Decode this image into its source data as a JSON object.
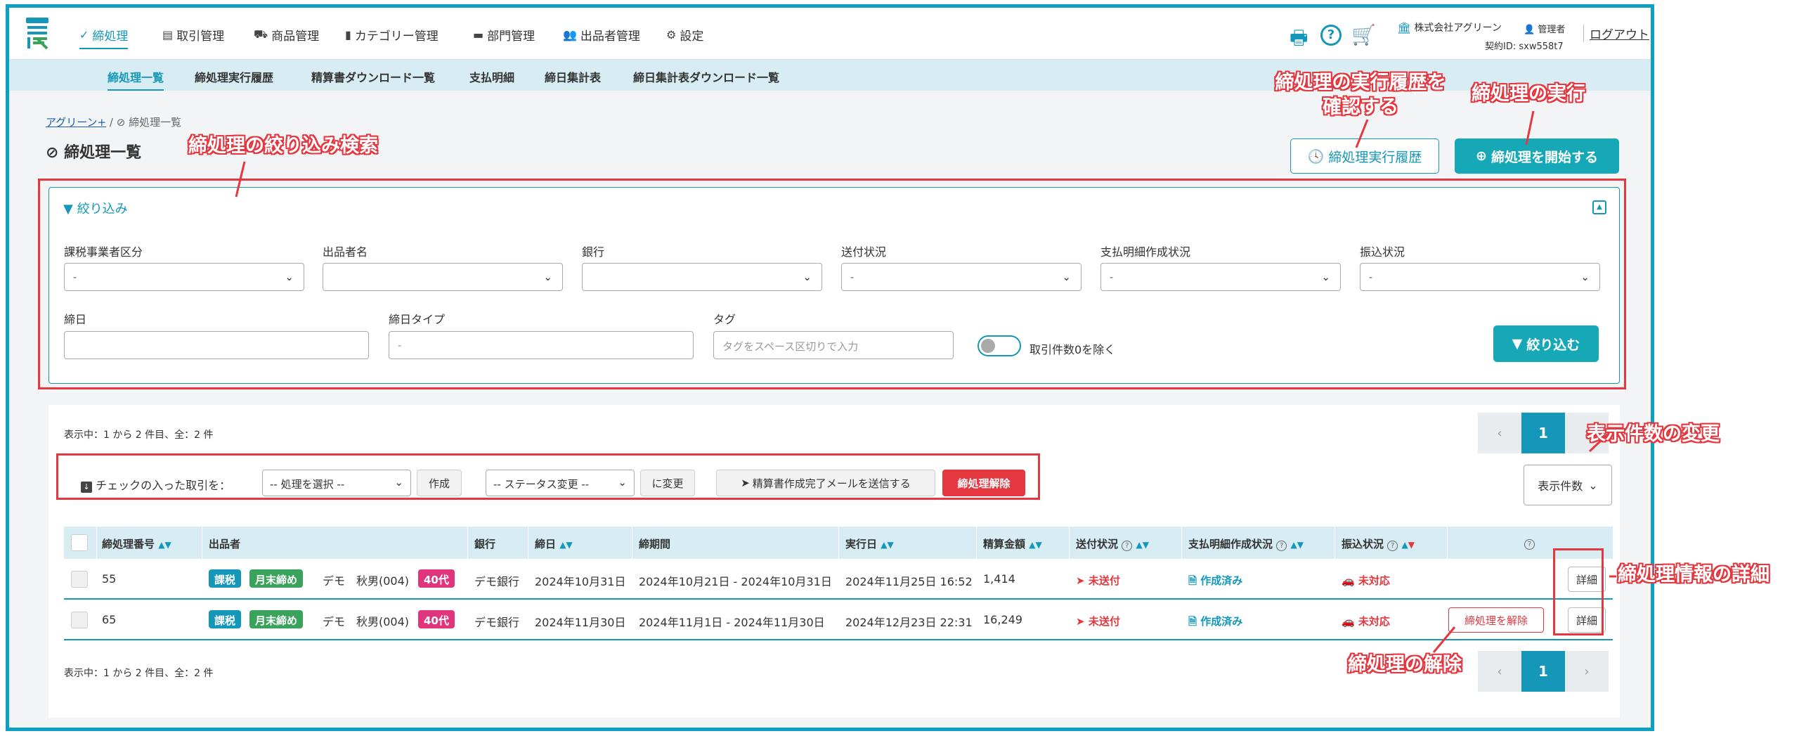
{
  "nav": {
    "items": [
      "締処理",
      "取引管理",
      "商品管理",
      "カテゴリー管理",
      "部門管理",
      "出品者管理",
      "設定"
    ],
    "company": "株式会社アグリーン",
    "user": "管理者",
    "contract": "契約ID: sxw558t7",
    "logout": "ログアウト"
  },
  "subnav": {
    "items": [
      "締処理一覧",
      "締処理実行履歴",
      "精算書ダウンロード一覧",
      "支払明細",
      "締日集計表",
      "締日集計表ダウンロード一覧"
    ]
  },
  "breadcrumb": {
    "root": "アグリーン+",
    "sep": "/",
    "current": "締処理一覧"
  },
  "page_title": "締処理一覧",
  "buttons": {
    "history": "締処理実行履歴",
    "start": "締処理を開始する"
  },
  "filter": {
    "title": "絞り込み",
    "tax_label": "課税事業者区分",
    "tax_value": "-",
    "seller_label": "出品者名",
    "seller_value": "",
    "bank_label": "銀行",
    "bank_value": "",
    "send_label": "送付状況",
    "send_value": "-",
    "pay_label": "支払明細作成状況",
    "pay_value": "-",
    "transfer_label": "振込状況",
    "transfer_value": "-",
    "close_label": "締日",
    "close_value": "",
    "close_type_label": "締日タイプ",
    "close_type_value": "-",
    "tag_label": "タグ",
    "tag_placeholder": "タグをスペース区切りで入力",
    "exclude_zero": "取引件数0を除く",
    "submit": "絞り込む"
  },
  "list": {
    "summary_top": "表示中：1 から 2 件目、全：2 件",
    "summary_bottom": "表示中：1 から 2 件目、全：2 件",
    "page": "1",
    "prev": "‹",
    "next": "›",
    "bulk_label": "チェックの入った取引を：",
    "process_select": "-- 処理を選択 --",
    "create": "作成",
    "status_select": "-- ステータス変更 --",
    "change": "に変更",
    "send_mail": "精算書作成完了メールを送信する",
    "cancel_close": "締処理解除",
    "per_page": "表示件数"
  },
  "table": {
    "headers": [
      "締処理番号",
      "出品者",
      "銀行",
      "締日",
      "締期間",
      "実行日",
      "精算金額",
      "送付状況",
      "支払明細作成状況",
      "振込状況"
    ],
    "rows": [
      {
        "id": "55",
        "badges": [
          "課税",
          "月末締め"
        ],
        "seller": "デモ　秋男(004)",
        "age": "40代",
        "bank": "デモ銀行",
        "close_date": "2024年10月31日",
        "period": "2024年10月21日 - 2024年10月31日",
        "exec": "2024年11月25日 16:52",
        "amount": "1,414",
        "send": "未送付",
        "pay": "作成済み",
        "transfer": "未対応",
        "release": "",
        "detail": "詳細"
      },
      {
        "id": "65",
        "badges": [
          "課税",
          "月末締め"
        ],
        "seller": "デモ　秋男(004)",
        "age": "40代",
        "bank": "デモ銀行",
        "close_date": "2024年11月30日",
        "period": "2024年11月1日 - 2024年11月30日",
        "exec": "2024年12月23日 22:31",
        "amount": "16,249",
        "send": "未送付",
        "pay": "作成済み",
        "transfer": "未対応",
        "release": "締処理を解除",
        "detail": "詳細"
      }
    ]
  },
  "annotations": {
    "filter_search": "締処理の絞り込み検索",
    "history_line1": "締処理の実行履歴を",
    "history_line2": "確認する",
    "execute": "締処理の実行",
    "per_page": "表示件数の変更",
    "detail": "締処理情報の詳細",
    "release": "締処理の解除"
  },
  "colors": {
    "accent": "#1497b8",
    "teal": "#17a8b8",
    "danger": "#e4373f",
    "subnav": "#d7ecf3"
  }
}
